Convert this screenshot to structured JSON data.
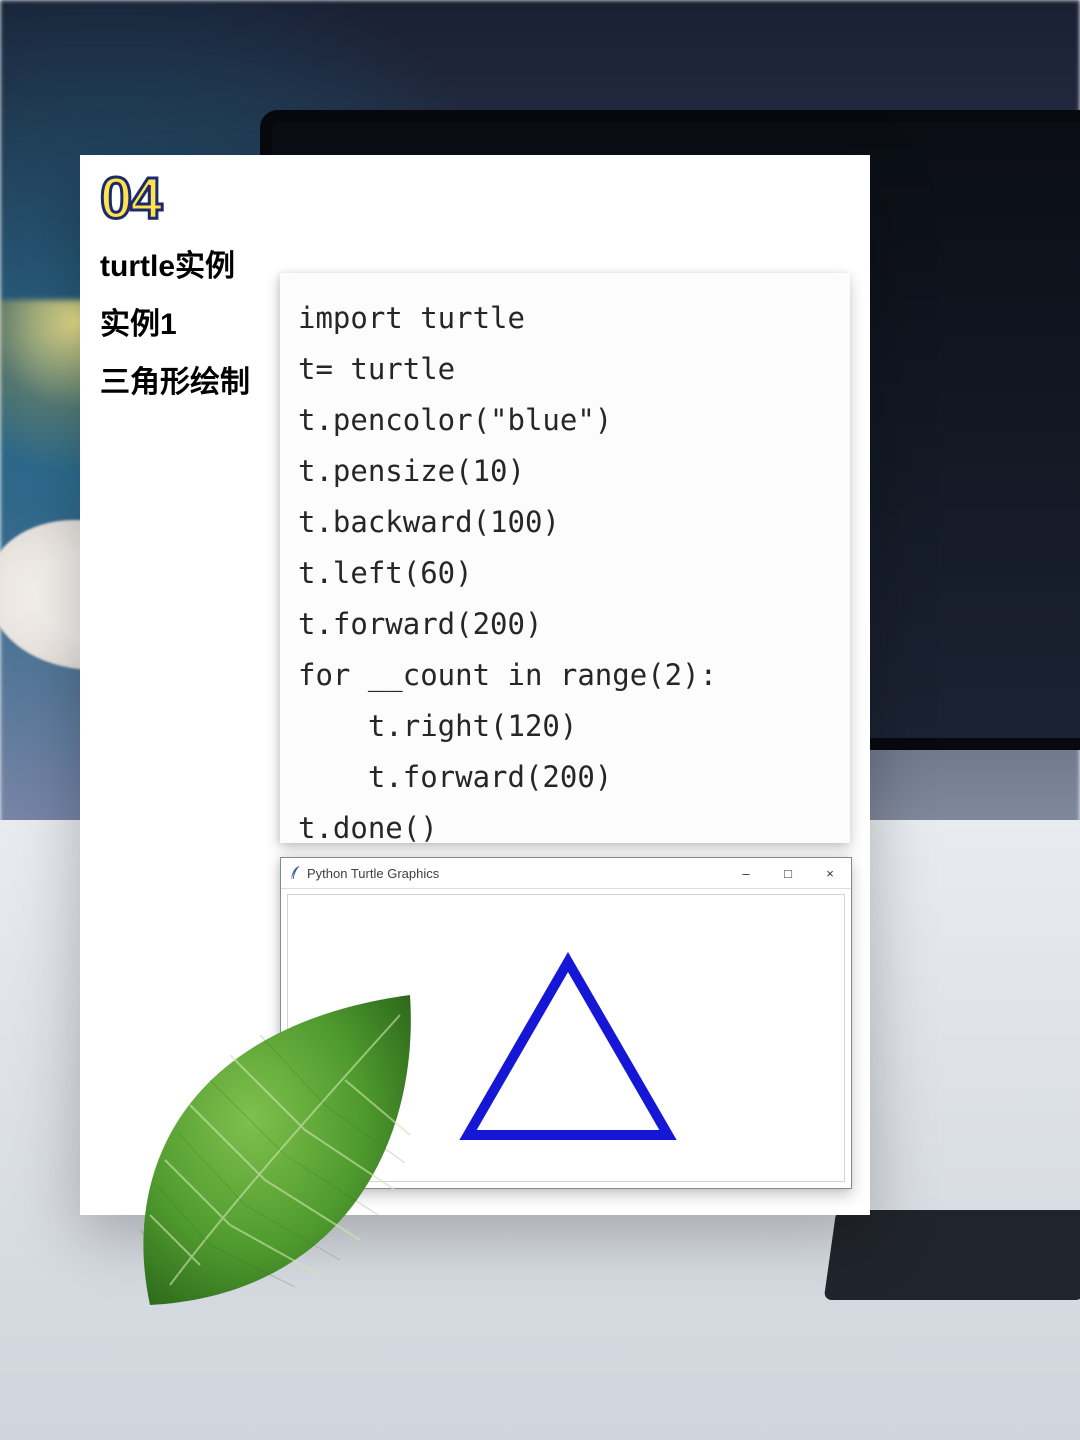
{
  "badge_number": "04",
  "titles": {
    "line1": "turtle实例",
    "line2": "实例1",
    "line3": "三角形绘制"
  },
  "code": "import turtle\nt= turtle\nt.pencolor(\"blue\")\nt.pensize(10)\nt.backward(100)\nt.left(60)\nt.forward(200)\nfor __count in range(2):\n    t.right(120)\n    t.forward(200)\nt.done()",
  "turtle_window": {
    "title": "Python Turtle Graphics",
    "buttons": {
      "minimize": "–",
      "maximize": "□",
      "close": "×"
    }
  },
  "triangle": {
    "stroke": "#1616d6",
    "stroke_width": 10
  }
}
